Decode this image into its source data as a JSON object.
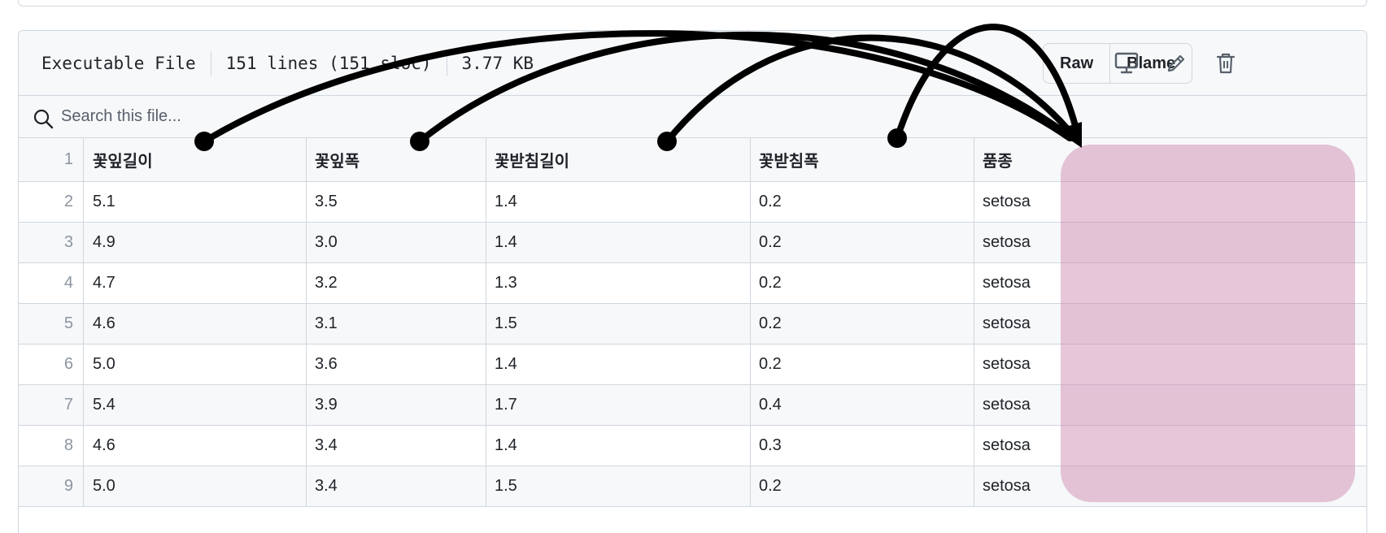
{
  "file_header": {
    "file_type": "Executable File",
    "lines": "151 lines (151 sloc)",
    "size": "3.77 KB",
    "raw_label": "Raw",
    "blame_label": "Blame"
  },
  "search": {
    "placeholder": "Search this file..."
  },
  "table": {
    "headers": [
      "꽃잎길이",
      "꽃잎폭",
      "꽃받침길이",
      "꽃받침폭",
      "품종"
    ],
    "rows": [
      {
        "line": "2",
        "cells": [
          "5.1",
          "3.5",
          "1.4",
          "0.2",
          "setosa"
        ]
      },
      {
        "line": "3",
        "cells": [
          "4.9",
          "3.0",
          "1.4",
          "0.2",
          "setosa"
        ]
      },
      {
        "line": "4",
        "cells": [
          "4.7",
          "3.2",
          "1.3",
          "0.2",
          "setosa"
        ]
      },
      {
        "line": "5",
        "cells": [
          "4.6",
          "3.1",
          "1.5",
          "0.2",
          "setosa"
        ]
      },
      {
        "line": "6",
        "cells": [
          "5.0",
          "3.6",
          "1.4",
          "0.2",
          "setosa"
        ]
      },
      {
        "line": "7",
        "cells": [
          "5.4",
          "3.9",
          "1.7",
          "0.4",
          "setosa"
        ]
      },
      {
        "line": "8",
        "cells": [
          "4.6",
          "3.4",
          "1.4",
          "0.3",
          "setosa"
        ]
      },
      {
        "line": "9",
        "cells": [
          "5.0",
          "3.4",
          "1.5",
          "0.2",
          "setosa"
        ]
      }
    ],
    "header_line": "1"
  },
  "colors": {
    "highlight": "#c778a5",
    "border": "#d0d7de",
    "header_bg": "#f6f8fa"
  },
  "icons": [
    "desktop-icon",
    "pencil-icon",
    "trash-icon",
    "search-icon"
  ]
}
